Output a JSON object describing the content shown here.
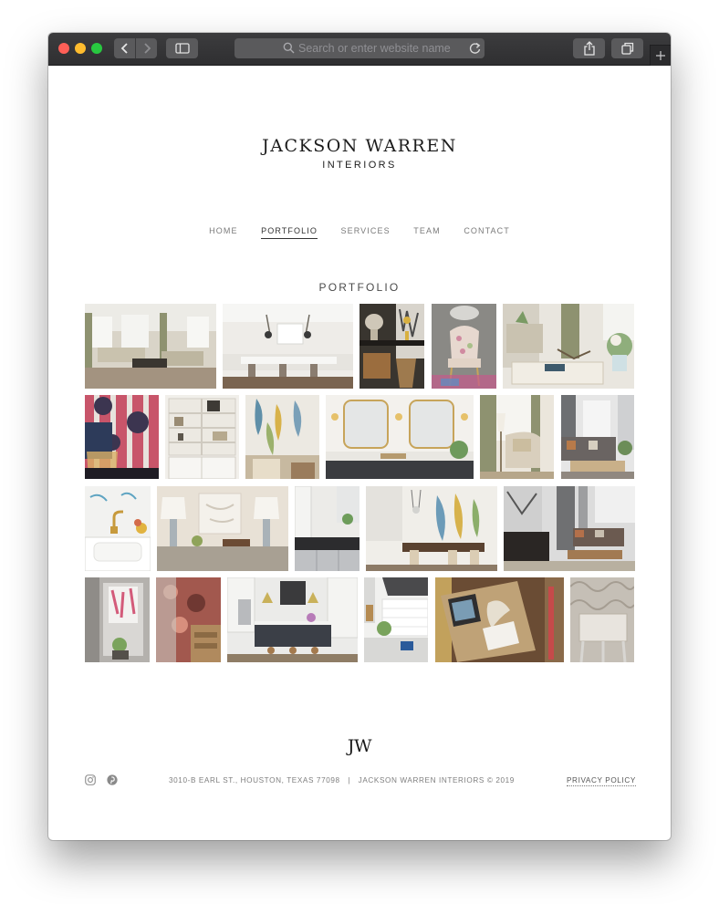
{
  "browser": {
    "address_placeholder": "Search or enter website name",
    "icons": [
      "back-icon",
      "forward-icon",
      "sidebar-icon",
      "search-icon",
      "reload-icon",
      "share-icon",
      "tabs-icon",
      "plus-icon"
    ]
  },
  "site": {
    "logo_main": "JACKSON WARREN",
    "logo_sub": "INTERIORS",
    "nav": [
      "HOME",
      "PORTFOLIO",
      "SERVICES",
      "TEAM",
      "CONTACT"
    ],
    "active_nav": "PORTFOLIO",
    "page_heading": "PORTFOLIO"
  },
  "footer": {
    "monogram": "JW",
    "address": "3010-B EARL ST., HOUSTON, TEXAS 77098   |   JACKSON WARREN INTERIORS © 2019",
    "privacy_label": "PRIVACY POLICY",
    "social_icons": [
      "instagram-icon",
      "pinterest-icon"
    ]
  },
  "portfolio": {
    "rows": [
      [
        "living-room",
        "white-kitchen",
        "entry-console",
        "floral-chair",
        "living-vignette"
      ],
      [
        "wallpaper-chair",
        "bookshelf",
        "abstract-art-wall",
        "double-vanity",
        "cream-armchair",
        "gray-sofa-room"
      ],
      [
        "brass-faucet",
        "lamp-console",
        "dark-counter-kitchen",
        "dining-room",
        "dark-wood-living-room"
      ],
      [
        "open-closet",
        "pink-wallpaper-bath",
        "island-kitchen",
        "range-hood-kitchen",
        "coffee-table-books",
        "silver-wallpaper"
      ]
    ]
  },
  "colors": {
    "chrome": "#38383a",
    "nav_active": "#333333",
    "nav_text": "#7a7a7a"
  }
}
